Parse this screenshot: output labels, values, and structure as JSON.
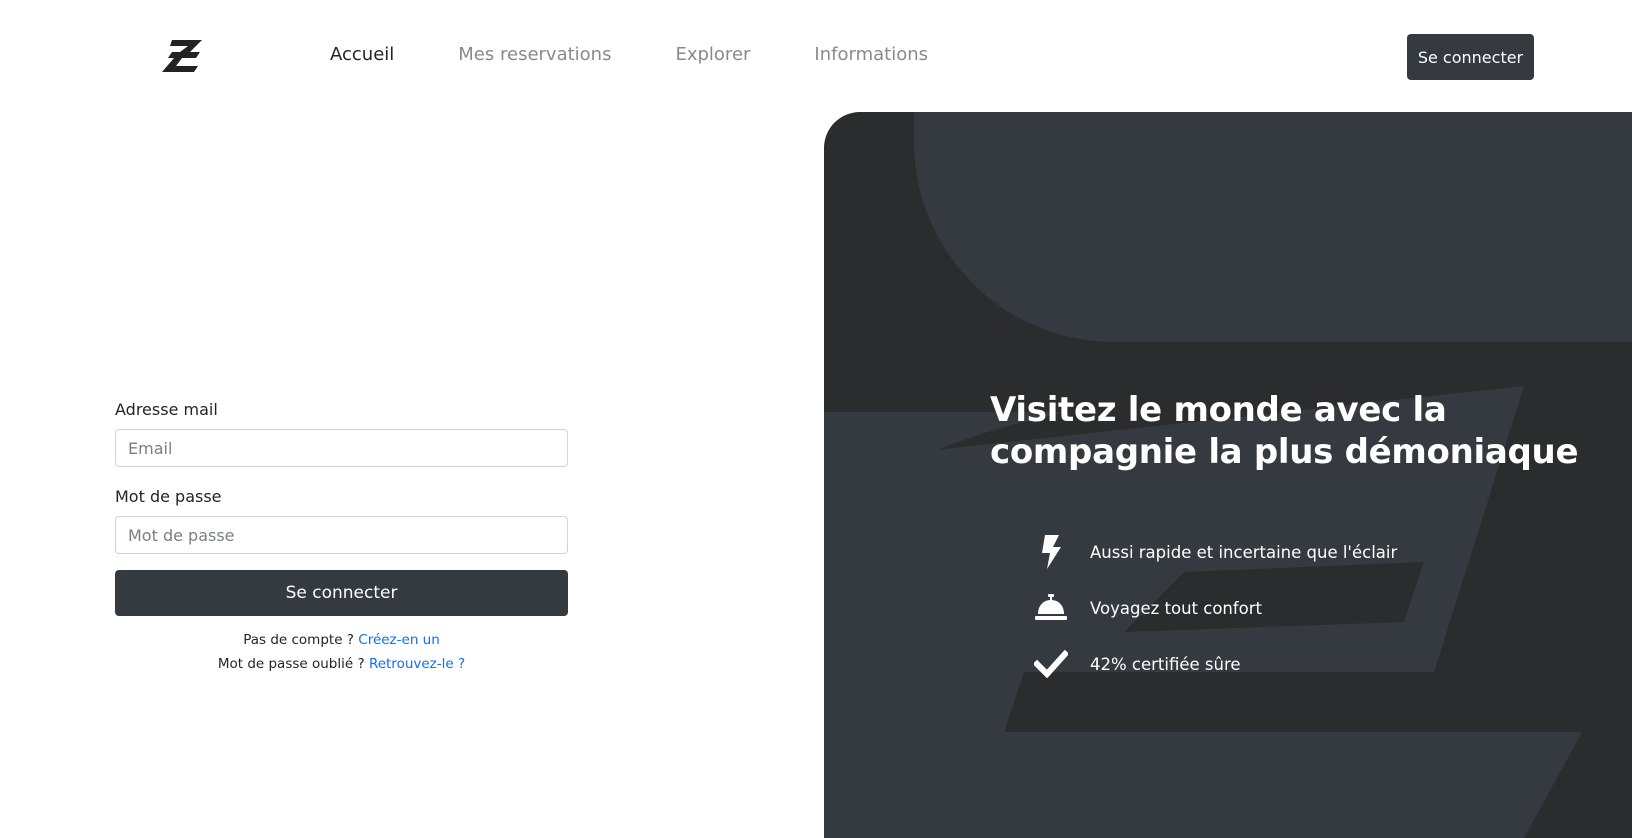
{
  "nav": {
    "logo_icon": "brand-logo-icon",
    "links": [
      {
        "label": "Accueil",
        "active": true
      },
      {
        "label": "Mes reservations",
        "active": false
      },
      {
        "label": "Explorer",
        "active": false
      },
      {
        "label": "Informations",
        "active": false
      }
    ],
    "login_label": "Se connecter"
  },
  "form": {
    "email_label": "Adresse mail",
    "email_placeholder": "Email",
    "email_value": "",
    "password_label": "Mot de passe",
    "password_placeholder": "Mot de passe",
    "password_value": "",
    "submit_label": "Se connecter",
    "no_account_text": "Pas de compte ?",
    "create_link": "Créez-en un",
    "forgot_text": "Mot de passe oublié ?",
    "recover_link": "Retrouvez-le ?"
  },
  "hero": {
    "title_line1": "Visitez le monde avec la",
    "title_line2": "compagnie la plus démoniaque",
    "features": [
      {
        "icon": "lightning-icon",
        "text": "Aussi rapide et incertaine que l'éclair"
      },
      {
        "icon": "service-bell-icon",
        "text": "Voyagez tout confort"
      },
      {
        "icon": "checkmark-icon",
        "text": "42% certifiée sûre"
      }
    ]
  },
  "colors": {
    "dark_button": "#343a40",
    "hero_background": "#2b2c2e",
    "hero_shape": "#353a40",
    "link_blue": "#0d6efd",
    "nav_inactive": "#8a8a8a"
  }
}
